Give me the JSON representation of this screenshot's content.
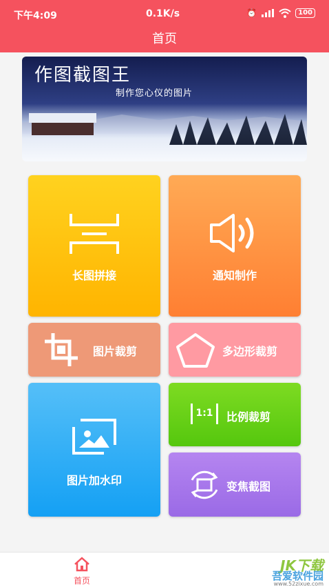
{
  "status_bar": {
    "time": "下午4:09",
    "network_speed": "0.1K/s",
    "battery": "100"
  },
  "header": {
    "title": "首页"
  },
  "banner": {
    "title": "作图截图王",
    "subtitle": "制作您心仪的图片"
  },
  "tiles": {
    "long_stitch": "长图拼接",
    "notice": "通知制作",
    "crop": "图片裁剪",
    "polygon_crop": "多边形裁剪",
    "watermark": "图片加水印",
    "ratio_crop": "比例裁剪",
    "ratio_icon_text": "1:1",
    "zoom_capture": "变焦截图"
  },
  "bottom_nav": {
    "home": "首页"
  },
  "watermark": {
    "brand": "JK下载",
    "site_name": "吾爱软件园",
    "url": "www.52zixue.com"
  },
  "colors": {
    "header": "#f5525e",
    "accent": "#f5525e"
  }
}
